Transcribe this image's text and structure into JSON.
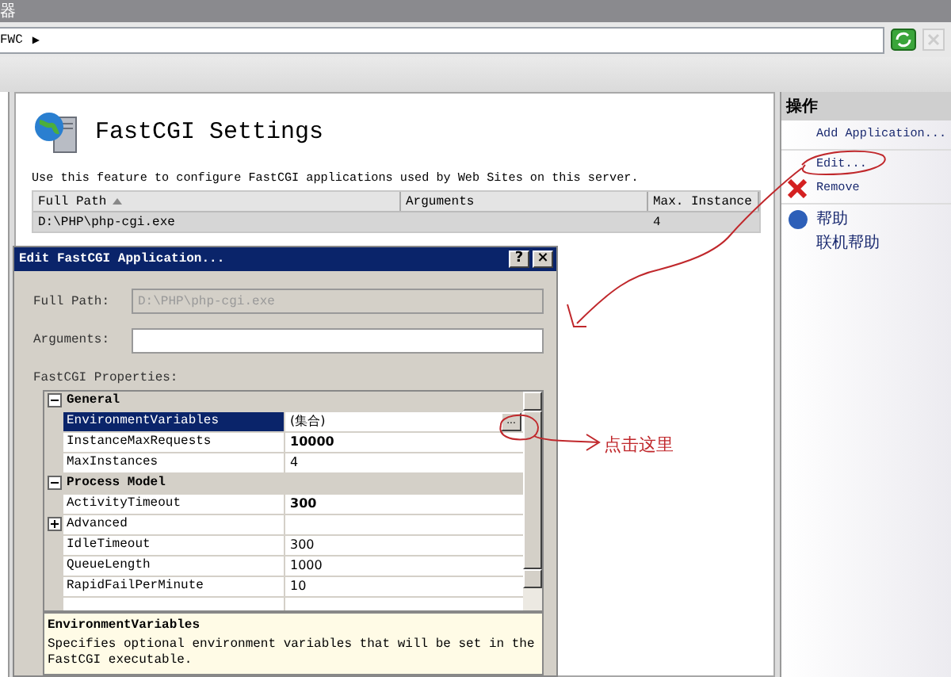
{
  "window": {
    "title": "器"
  },
  "address_bar": {
    "breadcrumb": "FWC",
    "separator": "▶"
  },
  "page": {
    "title": "FastCGI Settings",
    "description": "Use this feature to configure FastCGI applications used by Web Sites on this server.",
    "table": {
      "columns": [
        {
          "label": "Full Path",
          "sorted": true
        },
        {
          "label": "Arguments",
          "sorted": false
        },
        {
          "label": "Max. Instance",
          "sorted": false
        }
      ],
      "rows": [
        {
          "full_path": "D:\\PHP\\php-cgi.exe",
          "max_instances": "4",
          "selected": true
        }
      ]
    }
  },
  "actions": {
    "title": "操作",
    "groups": [
      [
        {
          "label": "Add Application...",
          "kind": "link"
        }
      ],
      [
        {
          "label": "Edit...",
          "kind": "link"
        },
        {
          "label": "Remove",
          "kind": "remove"
        }
      ],
      [
        {
          "label": "帮助",
          "kind": "help"
        },
        {
          "label": "联机帮助",
          "kind": "link"
        }
      ]
    ]
  },
  "dialog": {
    "title": "Edit FastCGI Application...",
    "help_button": "?",
    "close_button": "×",
    "fields": [
      {
        "label": "Full Path:",
        "value": "D:\\PHP\\php-cgi.exe",
        "disabled": true
      },
      {
        "label": "Arguments:",
        "disabled": false
      }
    ],
    "properties_label": "FastCGI Properties:",
    "properties": [
      {
        "kind": "category",
        "label": "General",
        "expanded": true,
        "children": [
          {
            "kind": "property",
            "name": "EnvironmentVariables",
            "value": "(集合)",
            "modified": false,
            "selected": true,
            "editor_button": "..."
          },
          {
            "kind": "property",
            "name": "InstanceMaxRequests",
            "value": "10000",
            "modified": true,
            "selected": false
          },
          {
            "kind": "property",
            "name": "MaxInstances",
            "value": "4",
            "modified": false,
            "selected": false
          }
        ]
      },
      {
        "kind": "category",
        "label": "Process Model",
        "expanded": true,
        "children": [
          {
            "kind": "property",
            "name": "ActivityTimeout",
            "value": "300",
            "modified": true,
            "selected": false
          },
          {
            "kind": "group",
            "label": "Advanced",
            "expanded": false
          },
          {
            "kind": "property",
            "name": "IdleTimeout",
            "value": "300",
            "modified": false,
            "selected": false
          },
          {
            "kind": "property",
            "name": "QueueLength",
            "value": "1000",
            "modified": false,
            "selected": false
          },
          {
            "kind": "property",
            "name": "RapidFailPerMinute",
            "value": "10",
            "modified": false,
            "selected": false
          }
        ]
      }
    ],
    "help": {
      "title": "EnvironmentVariables",
      "text": "Specifies optional environment variables that will be set in the FastCGI executable."
    }
  },
  "annotation": {
    "text": "点击这里"
  }
}
